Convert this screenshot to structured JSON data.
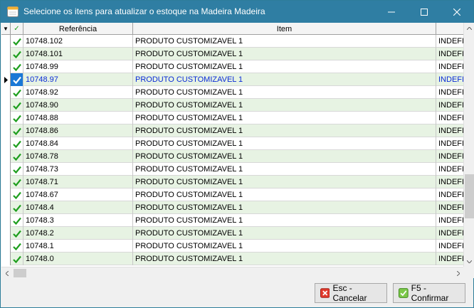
{
  "window": {
    "title": "Selecione os itens para atualizar o estoque na Madeira Madeira",
    "controls": [
      "minimize-icon",
      "maximize-icon",
      "close-icon"
    ]
  },
  "grid": {
    "columns": {
      "indicator": "▼",
      "check": "✓",
      "ref": "Referência",
      "item": "Item",
      "last": ""
    },
    "selected_index": 3,
    "rows": [
      {
        "ref": "10748.102",
        "item": "PRODUTO CUSTOMIZAVEL 1",
        "last": "INDEFI"
      },
      {
        "ref": "10748.101",
        "item": "PRODUTO CUSTOMIZAVEL 1",
        "last": "INDEFI"
      },
      {
        "ref": "10748.99",
        "item": "PRODUTO CUSTOMIZAVEL 1",
        "last": "INDEFI"
      },
      {
        "ref": "10748.97",
        "item": "PRODUTO CUSTOMIZAVEL 1",
        "last": "INDEFI"
      },
      {
        "ref": "10748.92",
        "item": "PRODUTO CUSTOMIZAVEL 1",
        "last": "INDEFI"
      },
      {
        "ref": "10748.90",
        "item": "PRODUTO CUSTOMIZAVEL 1",
        "last": "INDEFI"
      },
      {
        "ref": "10748.88",
        "item": "PRODUTO CUSTOMIZAVEL 1",
        "last": "INDEFI"
      },
      {
        "ref": "10748.86",
        "item": "PRODUTO CUSTOMIZAVEL 1",
        "last": "INDEFI"
      },
      {
        "ref": "10748.84",
        "item": "PRODUTO CUSTOMIZAVEL 1",
        "last": "INDEFI"
      },
      {
        "ref": "10748.78",
        "item": "PRODUTO CUSTOMIZAVEL 1",
        "last": "INDEFI"
      },
      {
        "ref": "10748.73",
        "item": "PRODUTO CUSTOMIZAVEL 1",
        "last": "INDEFI"
      },
      {
        "ref": "10748.71",
        "item": "PRODUTO CUSTOMIZAVEL 1",
        "last": "INDEFI"
      },
      {
        "ref": "10748.67",
        "item": "PRODUTO CUSTOMIZAVEL 1",
        "last": "INDEFI"
      },
      {
        "ref": "10748.4",
        "item": "PRODUTO CUSTOMIZAVEL 1",
        "last": "INDEFI"
      },
      {
        "ref": "10748.3",
        "item": "PRODUTO CUSTOMIZAVEL 1",
        "last": "INDEFI"
      },
      {
        "ref": "10748.2",
        "item": "PRODUTO CUSTOMIZAVEL 1",
        "last": "INDEFI"
      },
      {
        "ref": "10748.1",
        "item": "PRODUTO CUSTOMIZAVEL 1",
        "last": "INDEFI"
      },
      {
        "ref": "10748.0",
        "item": "PRODUTO CUSTOMIZAVEL 1",
        "last": "INDEFI"
      }
    ]
  },
  "buttons": {
    "cancel": "Esc - Cancelar",
    "confirm": "F5 - Confirmar"
  },
  "colors": {
    "titlebar": "#2f7ea3",
    "row_alt": "#e7f3e3",
    "check": "#1e9e1e",
    "selected_text": "#0a2bd6",
    "selected_check_bg": "#1a78d6"
  }
}
